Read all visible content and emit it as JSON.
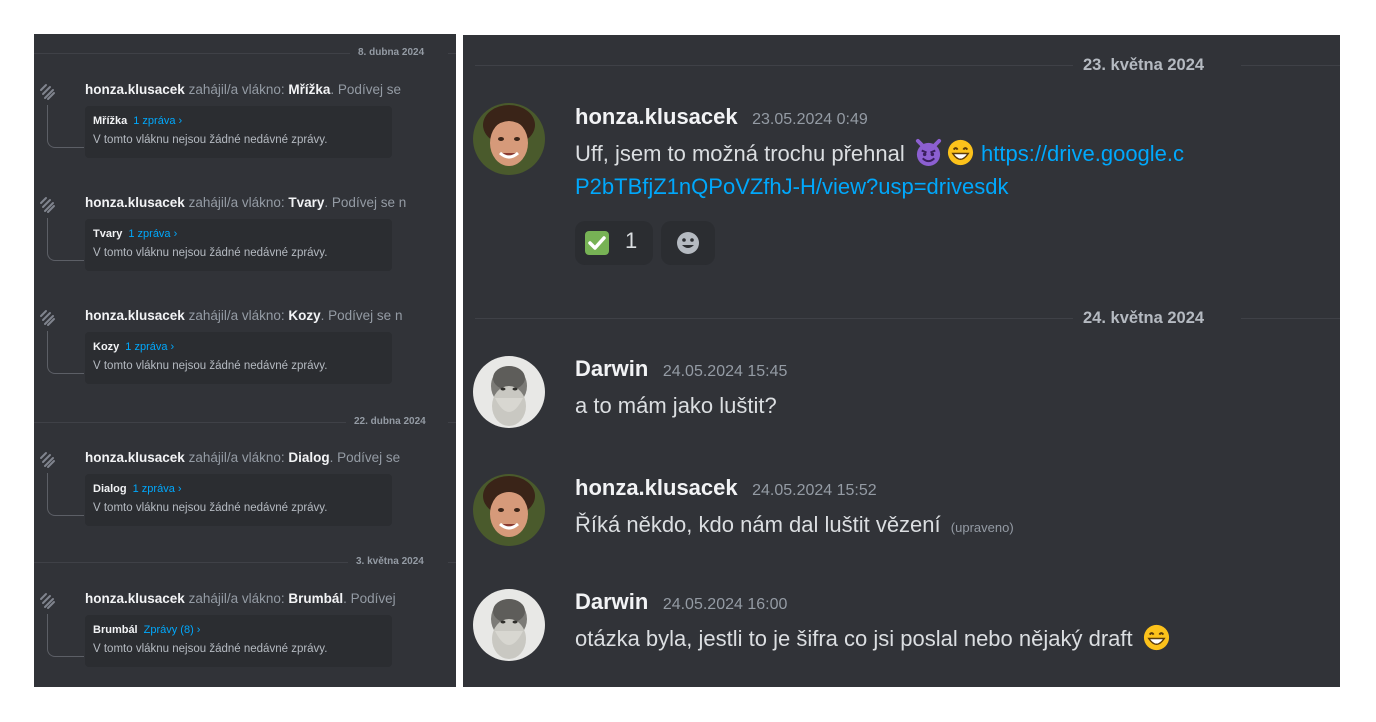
{
  "left_panel": {
    "dividers": [
      "8. dubna 2024",
      "22. dubna 2024",
      "3. května 2024"
    ],
    "threads": [
      {
        "author": "honza.klusacek",
        "started_text": "zahájil/a vlákno:",
        "thread_name": "Mřížka",
        "suffix": ". Podívej se",
        "card_name": "Mřížka",
        "card_count": "1 zpráva ›",
        "card_status": "V tomto vláknu nejsou žádné nedávné zprávy."
      },
      {
        "author": "honza.klusacek",
        "started_text": "zahájil/a vlákno:",
        "thread_name": "Tvary",
        "suffix": ". Podívej se n",
        "card_name": "Tvary",
        "card_count": "1 zpráva ›",
        "card_status": "V tomto vláknu nejsou žádné nedávné zprávy."
      },
      {
        "author": "honza.klusacek",
        "started_text": "zahájil/a vlákno:",
        "thread_name": "Kozy",
        "suffix": ". Podívej se n",
        "card_name": "Kozy",
        "card_count": "1 zpráva ›",
        "card_status": "V tomto vláknu nejsou žádné nedávné zprávy."
      },
      {
        "author": "honza.klusacek",
        "started_text": "zahájil/a vlákno:",
        "thread_name": "Dialog",
        "suffix": ". Podívej se",
        "card_name": "Dialog",
        "card_count": "1 zpráva ›",
        "card_status": "V tomto vláknu nejsou žádné nedávné zprávy."
      },
      {
        "author": "honza.klusacek",
        "started_text": "zahájil/a vlákno:",
        "thread_name": "Brumbál",
        "suffix": ". Podívej",
        "card_name": "Brumbál",
        "card_count": "Zprávy (8) ›",
        "card_status": "V tomto vláknu nejsou žádné nedávné zprávy."
      }
    ]
  },
  "right_panel": {
    "dividers": [
      "23. května 2024",
      "24. května 2024"
    ],
    "messages": [
      {
        "username": "honza.klusacek",
        "timestamp": "23.05.2024 0:49",
        "text": "Uff, jsem to možná trochu přehnal",
        "emojis": [
          "smiling-imp-emoji",
          "grin-emoji"
        ],
        "link_line1": "https://drive.google.c",
        "link_line2": "P2bTBfjZ1nQPoVZfhJ-H/view?usp=drivesdk",
        "reaction": {
          "emoji": "check-mark-emoji",
          "count": "1"
        }
      },
      {
        "username": "Darwin",
        "timestamp": "24.05.2024 15:45",
        "text": "a to mám jako luštit?"
      },
      {
        "username": "honza.klusacek",
        "timestamp": "24.05.2024 15:52",
        "text": "Říká někdo, kdo nám dal luštit vězení",
        "edited": "(upraveno)"
      },
      {
        "username": "Darwin",
        "timestamp": "24.05.2024 16:00",
        "text": "otázka byla, jestli to je šifra co jsi poslal nebo nějaký draft",
        "emojis": [
          "grin-emoji"
        ]
      }
    ]
  },
  "colors": {
    "background": "#313338",
    "accent_link": "#00a8fc",
    "text": "#dbdee1",
    "muted": "#949ba4"
  }
}
